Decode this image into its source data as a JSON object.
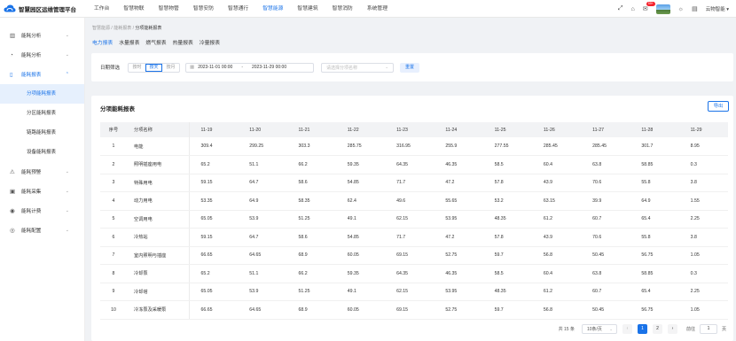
{
  "app": {
    "title": "智慧园区运维管理平台"
  },
  "topnav": [
    {
      "label": "工作台",
      "active": false
    },
    {
      "label": "智慧物联",
      "active": false
    },
    {
      "label": "智慧物管",
      "active": false
    },
    {
      "label": "智慧安防",
      "active": false
    },
    {
      "label": "智慧通行",
      "active": false
    },
    {
      "label": "智慧能源",
      "active": true
    },
    {
      "label": "智慧建筑",
      "active": false
    },
    {
      "label": "智慧消防",
      "active": false
    },
    {
      "label": "系统管理",
      "active": false
    }
  ],
  "topright": {
    "badge": "99+",
    "user": "云物智能"
  },
  "sidebar": {
    "items": [
      {
        "label": "能耗分析",
        "icon": "bar-chart-icon"
      },
      {
        "label": "能耗分析",
        "icon": "clock-icon"
      },
      {
        "label": "能耗报表",
        "icon": "document-icon"
      },
      {
        "label": "能耗预警",
        "icon": "warning-icon"
      },
      {
        "label": "能耗采集",
        "icon": "clipboard-icon"
      },
      {
        "label": "能耗计费",
        "icon": "money-icon"
      },
      {
        "label": "能耗配置",
        "icon": "settings-icon"
      }
    ],
    "submenu": [
      {
        "label": "分项能耗报表",
        "active": true
      },
      {
        "label": "分区能耗报表",
        "active": false
      },
      {
        "label": "链路能耗报表",
        "active": false
      },
      {
        "label": "设备能耗报表",
        "active": false
      }
    ]
  },
  "breadcrumb": {
    "part1": "智慧能源",
    "sep": "/",
    "part2": "能耗报表",
    "current": "分项能耗报表"
  },
  "tabs": [
    {
      "label": "电力报表",
      "active": true
    },
    {
      "label": "水量报表",
      "active": false
    },
    {
      "label": "燃气报表",
      "active": false
    },
    {
      "label": "热量报表",
      "active": false
    },
    {
      "label": "冷量报表",
      "active": false
    }
  ],
  "filter": {
    "label": "日期筛选",
    "segments": [
      {
        "label": "按时",
        "active": false
      },
      {
        "label": "按天",
        "active": true
      },
      {
        "label": "按月",
        "active": false
      }
    ],
    "start": "2023-11-01 00:00",
    "range_sep": "-",
    "end": "2023-11-29 00:00",
    "select_placeholder": "请选择分项名称",
    "reset_label": "重置"
  },
  "card": {
    "title": "分项能耗报表",
    "export_label": "导出"
  },
  "table": {
    "headers": [
      "序号",
      "分项名称",
      "11-19",
      "11-20",
      "11-21",
      "11-22",
      "11-23",
      "11-24",
      "11-25",
      "11-26",
      "11-27",
      "11-28",
      "11-29"
    ],
    "rows": [
      [
        "1",
        "电能",
        "309.4",
        "299.25",
        "303.3",
        "285.75",
        "316.95",
        "255.9",
        "277.55",
        "285.45",
        "285.45",
        "301.7",
        "8.95"
      ],
      [
        "2",
        "照明插座用电",
        "65.2",
        "51.1",
        "66.2",
        "59.35",
        "64.35",
        "46.35",
        "58.5",
        "60.4",
        "63.8",
        "58.85",
        "0.3"
      ],
      [
        "3",
        "特殊用电",
        "59.15",
        "64.7",
        "58.6",
        "54.85",
        "71.7",
        "47.2",
        "57.8",
        "43.9",
        "70.6",
        "55.8",
        "3.8"
      ],
      [
        "4",
        "动力用电",
        "53.35",
        "64.9",
        "58.35",
        "62.4",
        "49.6",
        "55.65",
        "53.2",
        "63.15",
        "39.9",
        "64.9",
        "1.55"
      ],
      [
        "5",
        "空调用电",
        "65.05",
        "53.9",
        "51.25",
        "49.1",
        "62.15",
        "53.95",
        "48.35",
        "61.2",
        "60.7",
        "65.4",
        "2.25"
      ],
      [
        "6",
        "冷热站",
        "59.15",
        "64.7",
        "58.6",
        "54.85",
        "71.7",
        "47.2",
        "57.8",
        "43.9",
        "70.6",
        "55.8",
        "3.8"
      ],
      [
        "7",
        "室内照明与插座",
        "66.65",
        "64.65",
        "68.9",
        "60.05",
        "69.15",
        "52.75",
        "59.7",
        "56.8",
        "50.45",
        "56.75",
        "1.05"
      ],
      [
        "8",
        "冷却泵",
        "65.2",
        "51.1",
        "66.2",
        "59.35",
        "64.35",
        "46.35",
        "58.5",
        "60.4",
        "63.8",
        "58.85",
        "0.3"
      ],
      [
        "9",
        "冷却塔",
        "65.05",
        "53.9",
        "51.25",
        "49.1",
        "62.15",
        "53.95",
        "48.35",
        "61.2",
        "60.7",
        "65.4",
        "2.25"
      ],
      [
        "10",
        "冷冻泵及采暖泵",
        "66.65",
        "64.65",
        "68.9",
        "60.05",
        "69.15",
        "52.75",
        "59.7",
        "56.8",
        "50.45",
        "56.75",
        "1.05"
      ]
    ]
  },
  "pager": {
    "total": "共 15 条",
    "page_size": "10条/页",
    "prev": "‹",
    "pages": [
      "1",
      "2"
    ],
    "current_page": "1",
    "next": "›",
    "goto_label": "前往",
    "goto_value": "1",
    "goto_suffix": "页"
  }
}
